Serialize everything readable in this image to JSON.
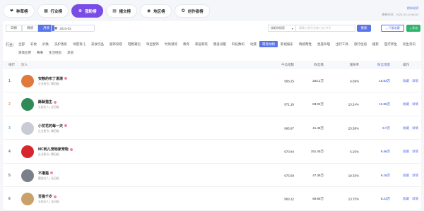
{
  "tabs": [
    {
      "label": "种草榜",
      "icon": "heart-icon",
      "active": false
    },
    {
      "label": "行业榜",
      "icon": "grid-icon",
      "active": false
    },
    {
      "label": "涨粉榜",
      "icon": "plus-circle-icon",
      "active": true
    },
    {
      "label": "播文榜",
      "icon": "document-icon",
      "active": false
    },
    {
      "label": "地区榜",
      "icon": "location-icon",
      "active": false
    },
    {
      "label": "创作者榜",
      "icon": "star-icon",
      "active": false
    }
  ],
  "header": {
    "help": "榜单说明",
    "update_time": "更新时间：2023-03-14 06:00"
  },
  "period": {
    "options": [
      "日榜",
      "周榜",
      "月榜"
    ],
    "selected": "月榜"
  },
  "date_value": "2023-02",
  "search": {
    "type_label": "按昵称搜索",
    "placeholder": "请输入账号名称/小红书号",
    "button": "搜索",
    "favorite": "只看收藏",
    "export": "导出"
  },
  "industry": {
    "label": "行业：",
    "items": [
      "全部",
      "彩妆",
      "护肤",
      "洗护香氛",
      "母婴育儿",
      "美食饮品",
      "服饰穿搭",
      "鞋靴箱包",
      "珠宝配饰",
      "时尚潮流",
      "教育",
      "家居家装",
      "健身减肥",
      "科技数码",
      "动漫",
      "萌宠动物",
      "影视娱乐",
      "情感两性",
      "星座命理",
      "出行工具",
      "旅行住宿",
      "摄影",
      "医疗养生",
      "民生资讯",
      "游戏应用",
      "赛事",
      "生活经验",
      "其他"
    ],
    "selected": "萌宠动物"
  },
  "table": {
    "headers": {
      "rank": "排行",
      "name": "达人",
      "index": "千瓜指数",
      "fans": "粉丝数",
      "rate": "涨粉率",
      "inc": "粉丝增量",
      "op": "操作"
    },
    "op_labels": {
      "fav": "收藏",
      "detail": "详情"
    },
    "rows": [
      {
        "rank": "1",
        "name": "安静的布丁滚滚",
        "tag": "企业账号 | 腾冠级",
        "index": "958.25",
        "fans": "253.1万",
        "rate": "6.69%",
        "inc": "16.93万",
        "rank_color": "#e5484d",
        "avatar_color": "#e07a3c"
      },
      {
        "rank": "2",
        "name": "酥酥猫生",
        "tag": "头部达人 | 金冠级",
        "index": "971.19",
        "fans": "83.02万",
        "rate": "13.24%",
        "inc": "10.99万",
        "rank_color": "#f08a24",
        "avatar_color": "#2e8b57"
      },
      {
        "rank": "3",
        "name": "小花花的每一天",
        "tag": "企业账号 | 腾冠级",
        "index": "966.97",
        "fans": "41.48万",
        "rate": "23.38%",
        "inc": "9.7万",
        "rank_color": "#3b9ee6",
        "avatar_color": "#c9ccd6"
      },
      {
        "rank": "4",
        "name": "MC刺儿宠物家宠物",
        "tag": "企业账号 | 腾冠级",
        "index": "970.84",
        "fans": "151.45万",
        "rate": "6.25%",
        "inc": "9.46万",
        "rank_color": "#666666",
        "avatar_color": "#d8262f"
      },
      {
        "rank": "5",
        "name": "不撸猫",
        "tag": "腰部达人 | 金冠级",
        "index": "975.68",
        "fans": "47.36万",
        "rate": "19.33%",
        "inc": "9.15万",
        "rank_color": "#666666",
        "avatar_color": "#7b7f89"
      },
      {
        "rank": "6",
        "name": "吾猫千岁",
        "tag": "头部达人 | 金冠级",
        "index": "969.12",
        "fans": "59.86万",
        "rate": "13.75%",
        "inc": "8.23万",
        "rank_color": "#666666",
        "avatar_color": "#c8a26a"
      }
    ]
  }
}
